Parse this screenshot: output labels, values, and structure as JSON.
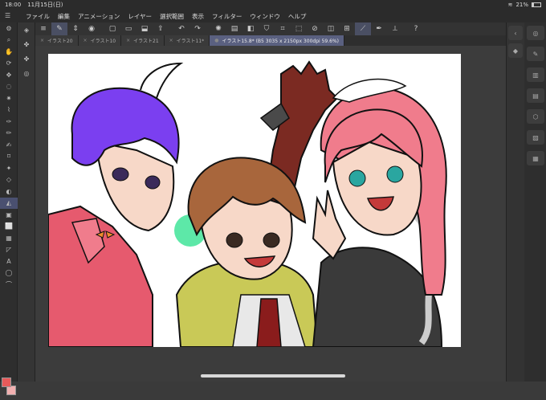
{
  "status": {
    "time": "18:00",
    "date": "11月15日(日)",
    "battery": "21%",
    "battery_level": 0.21
  },
  "menu": {
    "items": [
      "ファイル",
      "編集",
      "アニメーション",
      "レイヤー",
      "選択範囲",
      "表示",
      "フィルター",
      "ウィンドウ",
      "ヘルプ"
    ]
  },
  "tabs": [
    {
      "label": "イラスト20"
    },
    {
      "label": "イラスト10"
    },
    {
      "label": "イラスト21"
    },
    {
      "label": "イラスト11*"
    },
    {
      "label": "イラスト15.8* (B5 3035 x 2150px 300dpi 59.6%)"
    }
  ],
  "colors": {
    "main": "#e85a5a",
    "sub": "#f2b0b0",
    "accent": "#4a5070"
  }
}
